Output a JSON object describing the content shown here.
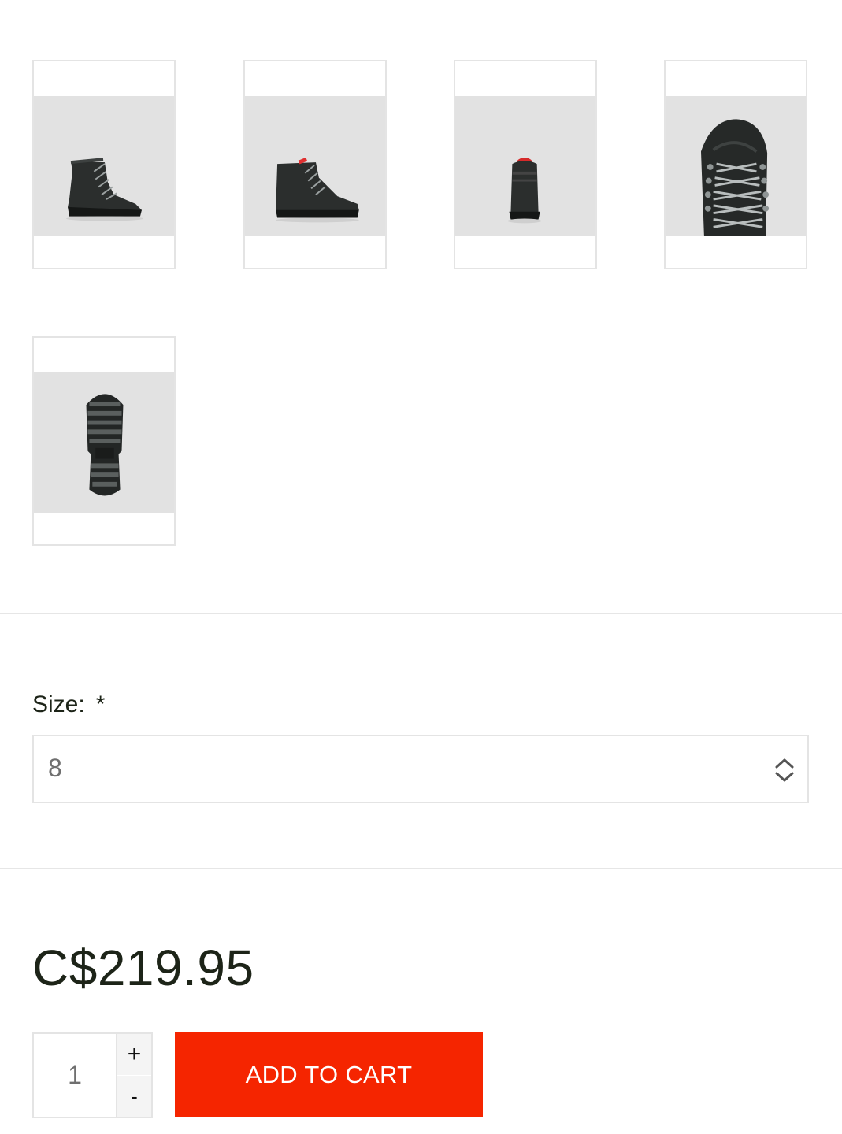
{
  "gallery": {
    "thumbnails": [
      {
        "icon": "boot-side-view-icon"
      },
      {
        "icon": "boot-inner-side-view-icon"
      },
      {
        "icon": "boot-back-view-icon"
      },
      {
        "icon": "boot-top-view-icon"
      },
      {
        "icon": "boot-sole-view-icon"
      }
    ]
  },
  "size": {
    "label": "Size:",
    "required_marker": "*",
    "selected_value": "8",
    "chevron_icon": "select-updown-icon"
  },
  "price": {
    "display": "C$219.95"
  },
  "quantity": {
    "value": "1",
    "increment_label": "+",
    "decrement_label": "-"
  },
  "cart": {
    "add_label": "ADD TO CART"
  },
  "colors": {
    "accent": "#f52500",
    "border": "#e4e4e4",
    "photo_bg": "#e2e2e2",
    "text_dark": "#1d2418",
    "text_muted": "#6f6f6f"
  }
}
